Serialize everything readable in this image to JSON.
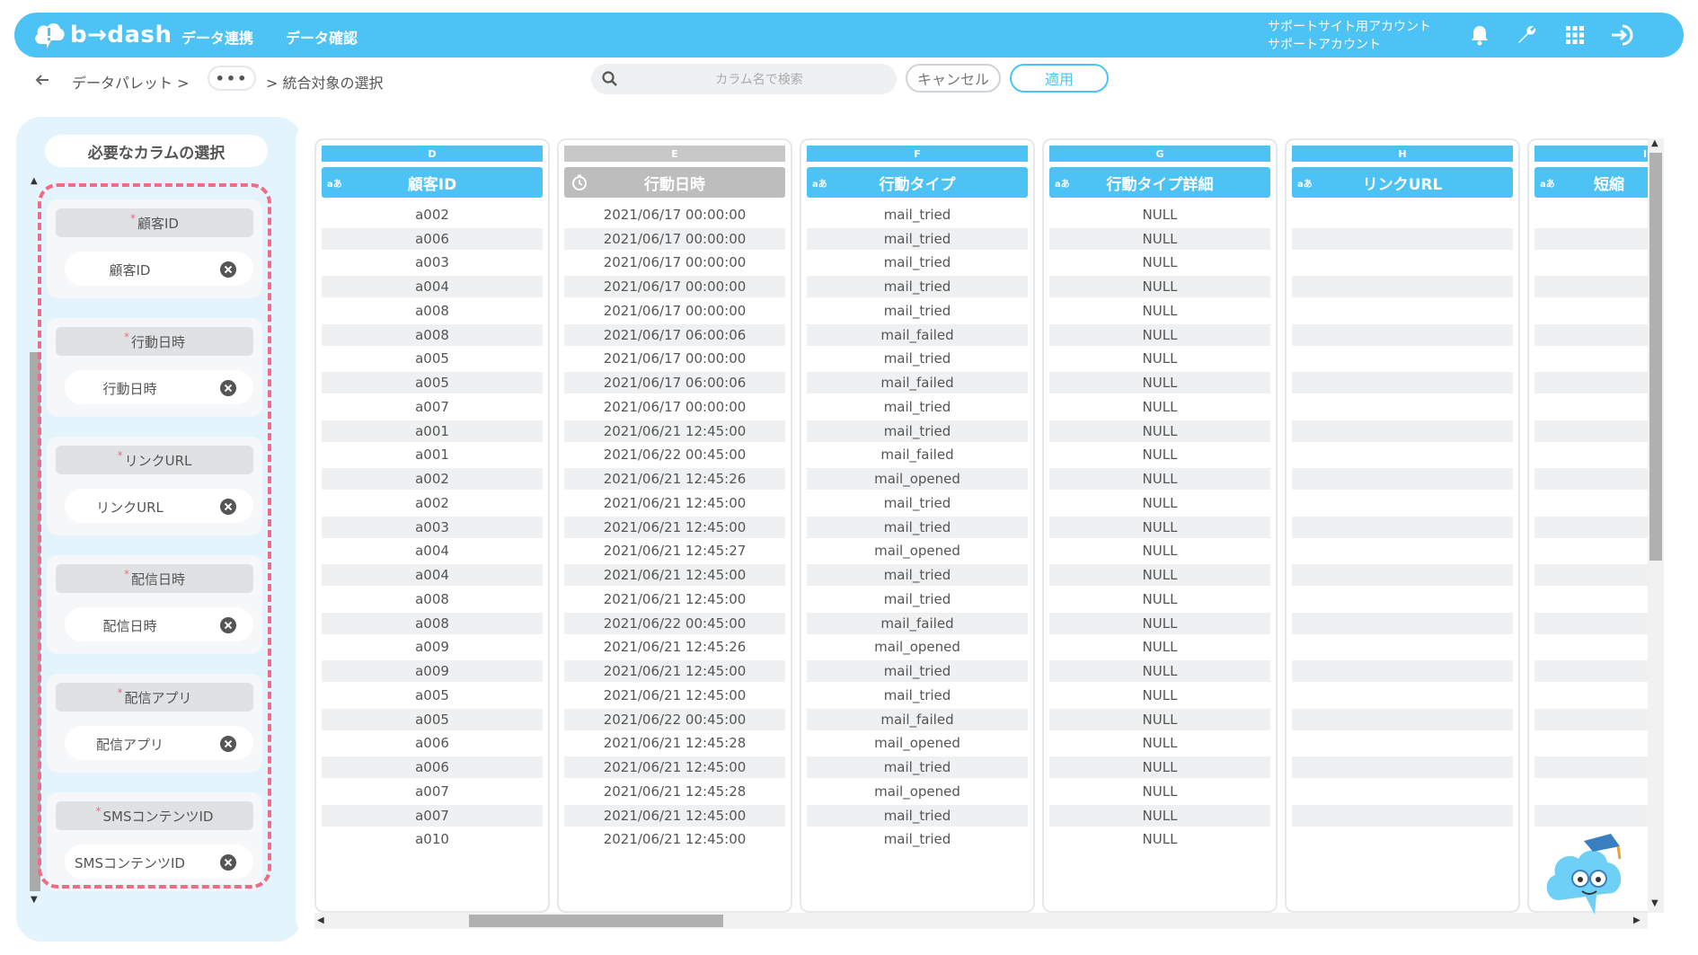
{
  "header": {
    "brand": "b→dash",
    "nav": [
      "データ連携",
      "データ確認"
    ],
    "account_line1": "サポートサイト用アカウント",
    "account_line2": "サポートアカウント",
    "icons": [
      "bell-icon",
      "wrench-icon",
      "apps-grid-icon",
      "logout-icon"
    ]
  },
  "toolbar": {
    "crumb_root": "データパレット >",
    "crumb_more": "•••",
    "crumb_current": "> 統合対象の選択",
    "search_placeholder": "カラム名で検索",
    "cancel_label": "キャンセル",
    "apply_label": "適用"
  },
  "left_panel": {
    "title": "必要なカラムの選択",
    "required_mark": "*",
    "slots": [
      {
        "label": "顧客ID",
        "value": "顧客ID"
      },
      {
        "label": "行動日時",
        "value": "行動日時"
      },
      {
        "label": "リンクURL",
        "value": "リンクURL"
      },
      {
        "label": "配信日時",
        "value": "配信日時"
      },
      {
        "label": "配信アプリ",
        "value": "配信アプリ"
      },
      {
        "label": "SMSコンテンツID",
        "value": "SMSコンテンツID"
      }
    ]
  },
  "grid": {
    "type_badge": "aあ",
    "columns": [
      {
        "letter": "D",
        "name": "顧客ID",
        "kind": "text"
      },
      {
        "letter": "E",
        "name": "行動日時",
        "kind": "datetime"
      },
      {
        "letter": "F",
        "name": "行動タイプ",
        "kind": "text"
      },
      {
        "letter": "G",
        "name": "行動タイプ詳細",
        "kind": "text"
      },
      {
        "letter": "H",
        "name": "リンクURL",
        "kind": "text"
      },
      {
        "letter": "I",
        "name": "短縮",
        "kind": "text"
      }
    ],
    "rows": [
      [
        "a002",
        "2021/06/17 00:00:00",
        "mail_tried",
        "NULL",
        "",
        ""
      ],
      [
        "a006",
        "2021/06/17 00:00:00",
        "mail_tried",
        "NULL",
        "",
        ""
      ],
      [
        "a003",
        "2021/06/17 00:00:00",
        "mail_tried",
        "NULL",
        "",
        ""
      ],
      [
        "a004",
        "2021/06/17 00:00:00",
        "mail_tried",
        "NULL",
        "",
        ""
      ],
      [
        "a008",
        "2021/06/17 00:00:00",
        "mail_tried",
        "NULL",
        "",
        ""
      ],
      [
        "a008",
        "2021/06/17 06:00:06",
        "mail_failed",
        "NULL",
        "",
        ""
      ],
      [
        "a005",
        "2021/06/17 00:00:00",
        "mail_tried",
        "NULL",
        "",
        ""
      ],
      [
        "a005",
        "2021/06/17 06:00:06",
        "mail_failed",
        "NULL",
        "",
        ""
      ],
      [
        "a007",
        "2021/06/17 00:00:00",
        "mail_tried",
        "NULL",
        "",
        ""
      ],
      [
        "a001",
        "2021/06/21 12:45:00",
        "mail_tried",
        "NULL",
        "",
        ""
      ],
      [
        "a001",
        "2021/06/22 00:45:00",
        "mail_failed",
        "NULL",
        "",
        ""
      ],
      [
        "a002",
        "2021/06/21 12:45:26",
        "mail_opened",
        "NULL",
        "",
        ""
      ],
      [
        "a002",
        "2021/06/21 12:45:00",
        "mail_tried",
        "NULL",
        "",
        ""
      ],
      [
        "a003",
        "2021/06/21 12:45:00",
        "mail_tried",
        "NULL",
        "",
        ""
      ],
      [
        "a004",
        "2021/06/21 12:45:27",
        "mail_opened",
        "NULL",
        "",
        ""
      ],
      [
        "a004",
        "2021/06/21 12:45:00",
        "mail_tried",
        "NULL",
        "",
        ""
      ],
      [
        "a008",
        "2021/06/21 12:45:00",
        "mail_tried",
        "NULL",
        "",
        ""
      ],
      [
        "a008",
        "2021/06/22 00:45:00",
        "mail_failed",
        "NULL",
        "",
        ""
      ],
      [
        "a009",
        "2021/06/21 12:45:26",
        "mail_opened",
        "NULL",
        "",
        ""
      ],
      [
        "a009",
        "2021/06/21 12:45:00",
        "mail_tried",
        "NULL",
        "",
        ""
      ],
      [
        "a005",
        "2021/06/21 12:45:00",
        "mail_tried",
        "NULL",
        "",
        ""
      ],
      [
        "a005",
        "2021/06/22 00:45:00",
        "mail_failed",
        "NULL",
        "",
        ""
      ],
      [
        "a006",
        "2021/06/21 12:45:28",
        "mail_opened",
        "NULL",
        "",
        ""
      ],
      [
        "a006",
        "2021/06/21 12:45:00",
        "mail_tried",
        "NULL",
        "",
        ""
      ],
      [
        "a007",
        "2021/06/21 12:45:28",
        "mail_opened",
        "NULL",
        "",
        ""
      ],
      [
        "a007",
        "2021/06/21 12:45:00",
        "mail_tried",
        "NULL",
        "",
        ""
      ],
      [
        "a010",
        "2021/06/21 12:45:00",
        "mail_tried",
        "NULL",
        "",
        ""
      ]
    ]
  },
  "colors": {
    "accent": "#4dc3f5",
    "required": "#f16b86",
    "panel_bg": "#e4f4fc"
  }
}
